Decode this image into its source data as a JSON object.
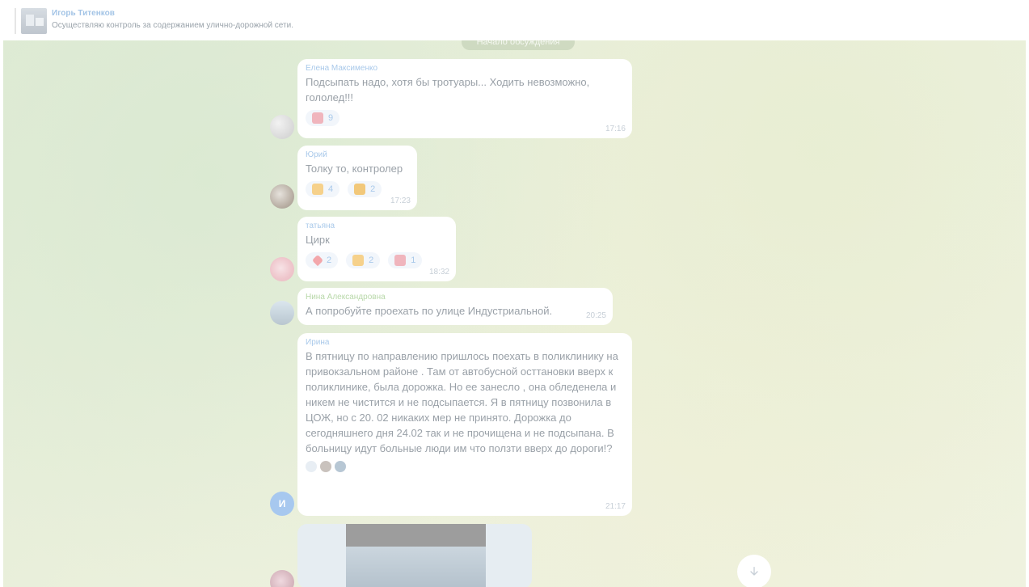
{
  "topbar": {
    "title": "Игорь Титенков",
    "subtitle": "Осуществляю контроль за содержанием улично-дорожной сети."
  },
  "chat": {
    "date_chip": "Начало обсуждения",
    "messages": [
      {
        "author": "Елена Максименко",
        "text": "Подсыпать надо, хотя бы тротуары... Ходить невозможно, гололед!!!",
        "time": "17:16",
        "reactions": [
          {
            "icon": "broken-heart-icon",
            "count": "9"
          }
        ]
      },
      {
        "author": "Юрий",
        "text": "Толку то, контролер",
        "time": "17:23",
        "reactions": [
          {
            "icon": "thumbs-up-icon",
            "count": "4"
          },
          {
            "icon": "thumbs-down-icon",
            "count": "2"
          }
        ]
      },
      {
        "author": "татьяна",
        "text": "Цирк",
        "time": "18:32",
        "reactions": [
          {
            "icon": "heart-icon",
            "count": "2"
          },
          {
            "icon": "thumbs-up-icon",
            "count": "2"
          },
          {
            "icon": "broken-heart-icon",
            "count": "1"
          }
        ]
      },
      {
        "author": "Нина Александровна",
        "text": "А попробуйте проехать по улице Индустриальной.",
        "time": "20:25",
        "reactions": []
      },
      {
        "author": "Ирина",
        "avatar_letter": "И",
        "text": "В пятницу по направлению пришлось поехать в поликлинику на привокзальном районе . Там от автобусной осттановки вверх к поликлинике, была дорожка. Но ее занесло , она обледенела и никем не чистится и не подсыпается. Я в пятницу позвонила в ЦОЖ, но с 20. 02 никаких мер не принято. Дорожка до сегодняшнего дня 24.02 так и не прочищена и не подсыпана. В больницу идут больные люди им что ползти вверх до дороги!?",
        "time": "21:17"
      }
    ]
  },
  "colors": {
    "author_blue": "#a9c9ea",
    "author_green": "#b8d8a9",
    "text_gray": "#9aa1a8"
  }
}
